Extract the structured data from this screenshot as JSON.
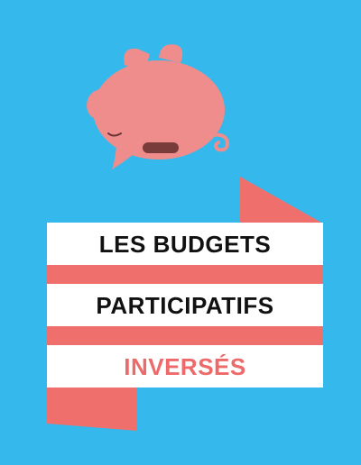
{
  "background_color": "#35b9ec",
  "ribbon_color": "#ef6f6c",
  "pig_color": "#ef8c8c",
  "slot_color": "#7a3b3b",
  "title": {
    "line1": "LES BUDGETS",
    "line2": "PARTICIPATIFS",
    "line3": "INVERSÉS",
    "line1_color": "#111111",
    "line2_color": "#111111",
    "line3_color": "#ee6a6a"
  },
  "illustration": {
    "icon": "piggy-bank-icon"
  }
}
